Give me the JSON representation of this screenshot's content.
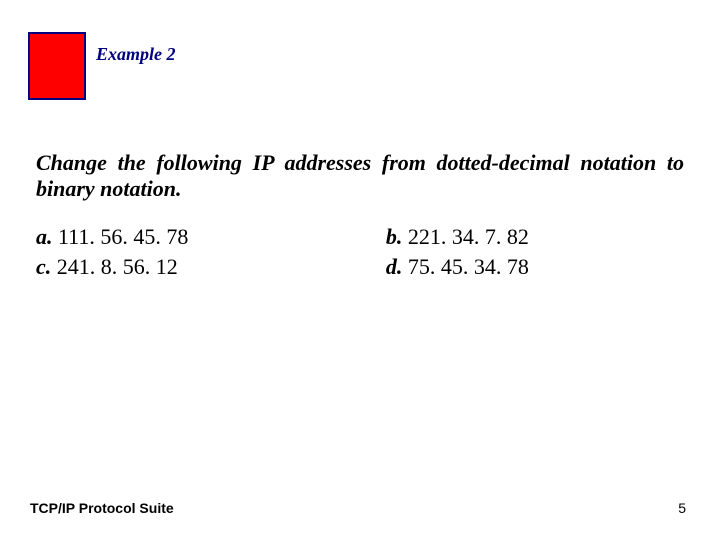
{
  "header": {
    "example_label": "Example 2"
  },
  "prompt": "Change the following IP addresses from dotted-decimal notation to binary notation.",
  "items": {
    "a": {
      "label": "a.",
      "value": "111. 56. 45. 78"
    },
    "b": {
      "label": "b.",
      "value": "221. 34. 7. 82"
    },
    "c": {
      "label": "c.",
      "value": "241. 8. 56. 12"
    },
    "d": {
      "label": "d.",
      "value": "75. 45. 34. 78"
    }
  },
  "footer": {
    "left": "TCP/IP Protocol Suite",
    "page_number": "5"
  }
}
